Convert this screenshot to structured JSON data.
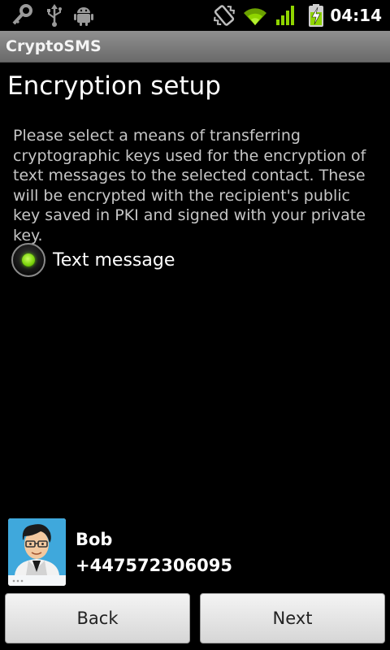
{
  "status_bar": {
    "time": "04:14",
    "icons": [
      "key-icon",
      "usb-icon",
      "android-debug-icon",
      "vibrate-icon",
      "wifi-icon",
      "signal-icon",
      "battery-charging-icon"
    ],
    "accent_color": "#8fd400"
  },
  "app": {
    "title": "CryptoSMS"
  },
  "main": {
    "heading": "Encryption setup",
    "description": "Please select a means of transferring cryptographic keys used for the encryption of text messages to the selected contact. These will be encrypted with the recipient's public key saved in PKI and signed with your private key.",
    "options": [
      {
        "label": "Text message",
        "selected": true
      }
    ]
  },
  "contact": {
    "name": "Bob",
    "phone": "+447572306095"
  },
  "buttons": {
    "back": "Back",
    "next": "Next"
  }
}
